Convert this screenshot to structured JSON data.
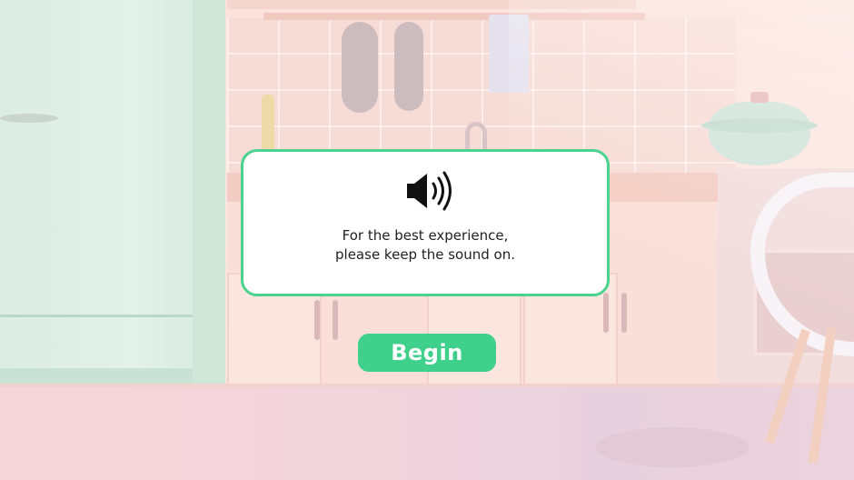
{
  "dialog": {
    "icon": "speaker-volume-icon",
    "message_line1": "For the best experience,",
    "message_line2": "please keep the sound on."
  },
  "begin_button": {
    "label": "Begin"
  },
  "colors": {
    "accent": "#3fd18b",
    "dialog_border": "#4ad28f",
    "dialog_background": "#ffffff",
    "text": "#222222"
  }
}
